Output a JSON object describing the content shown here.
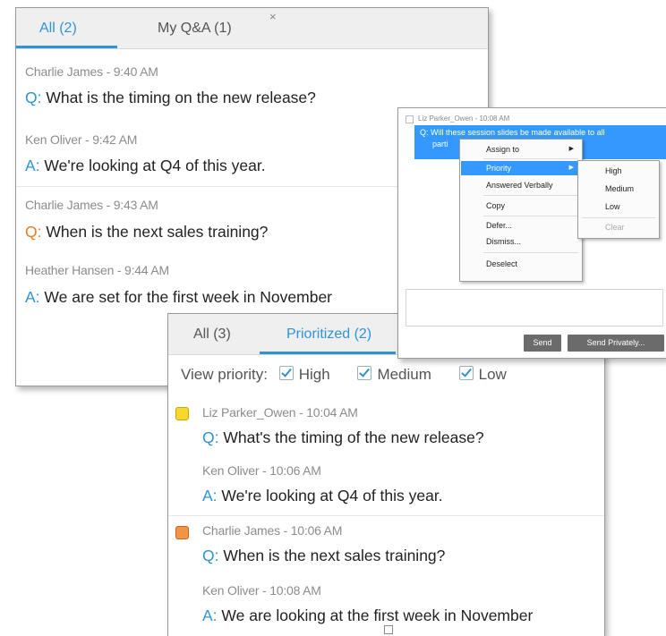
{
  "panel_all": {
    "tabs": [
      {
        "label": "All (2)",
        "active": true
      },
      {
        "label": "My Q&A (1)",
        "active": false
      }
    ],
    "close_glyph": "×",
    "items": [
      {
        "meta": "Charlie James - 9:40 AM",
        "prefix": "Q:",
        "text": " What is the timing on the new release?"
      },
      {
        "meta": "Ken Oliver - 9:42 AM",
        "prefix": "A:",
        "text": " We're looking at Q4 of this year."
      },
      {
        "meta": "Charlie James - 9:43 AM",
        "prefix": "Q:",
        "text": " When is the next sales training?"
      },
      {
        "meta": "Heather Hansen - 9:44 AM",
        "prefix": "A:",
        "text": " We are set for the first week in November"
      }
    ]
  },
  "panel_context": {
    "meta": "Liz Parker_Owen - 10:08 AM",
    "selected_line1": "Q: Will these session slides be made available to all",
    "selected_line2": "parti",
    "menu": [
      {
        "label": "Assign to",
        "submenu": true
      },
      {
        "label": "Priority",
        "submenu": true,
        "selected": true
      },
      {
        "label": "Answered Verbally"
      },
      {
        "label": "Copy"
      },
      {
        "label": "Defer..."
      },
      {
        "label": "Dismiss..."
      },
      {
        "label": "Deselect"
      }
    ],
    "submenu": [
      "High",
      "Medium",
      "Low",
      "Clear"
    ],
    "send_label": "Send",
    "send_privately_label": "Send Privately..."
  },
  "panel_prioritized": {
    "tabs": [
      {
        "label": "All (3)",
        "active": false
      },
      {
        "label": "Prioritized (2)",
        "active": true
      }
    ],
    "view_priority_label": "View priority:",
    "filters": [
      "High",
      "Medium",
      "Low"
    ],
    "items": [
      {
        "priority": "high",
        "meta": "Liz Parker_Owen - 10:04 AM",
        "prefix": "Q:",
        "text": " What's the timing of the new release?",
        "reply_meta": "Ken Oliver - 10:06 AM",
        "reply_prefix": "A:",
        "reply_text": " We're looking at Q4 of this year."
      },
      {
        "priority": "medium",
        "meta": "Charlie James - 10:06 AM",
        "prefix": "Q:",
        "text": " When is the next sales training?",
        "reply_meta": "Ken Oliver - 10:08 AM",
        "reply_prefix": "A:",
        "reply_text": " We are looking at the first week in November"
      }
    ]
  },
  "colors": {
    "accent": "#2f93d6",
    "question_orange": "#e87d28",
    "selection": "#3399ff",
    "high_flag": "#f7d82f",
    "medium_flag": "#f09445"
  }
}
